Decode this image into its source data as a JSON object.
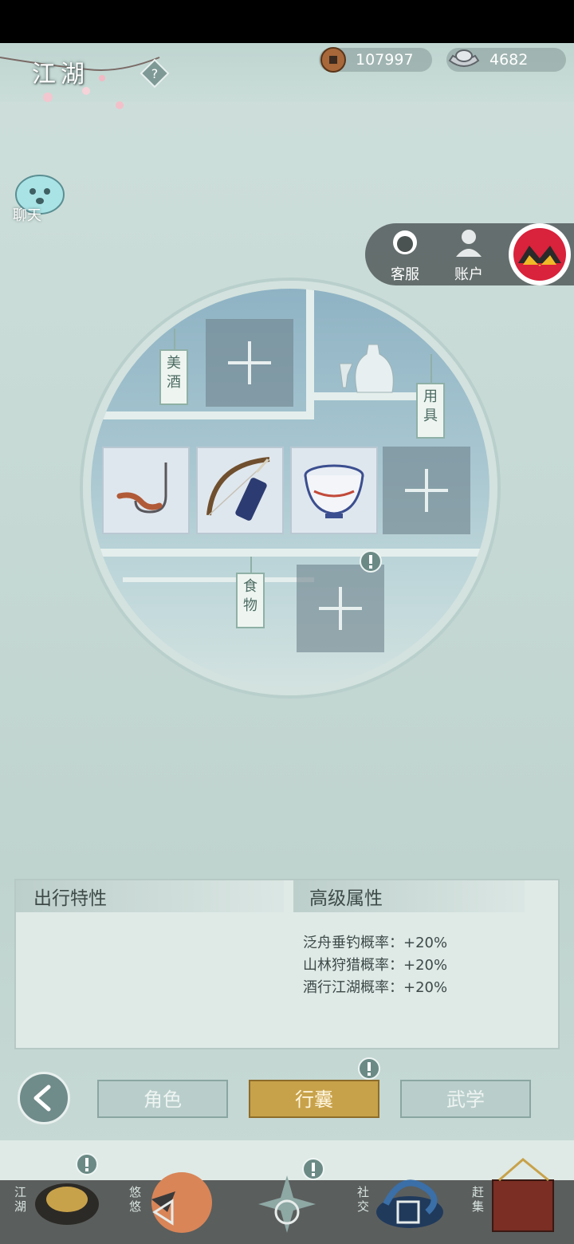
{
  "header": {
    "title": "江湖",
    "copper": "107997",
    "silver": "4682"
  },
  "chat": {
    "label": "聊天"
  },
  "service_panel": {
    "kefu": "客服",
    "account": "账户"
  },
  "shelf": {
    "tags": {
      "wine": "美酒",
      "tools": "用具",
      "food": "食物"
    },
    "items": [
      "fishing-hook",
      "bow-and-quiver",
      "porcelain-bowl"
    ]
  },
  "attributes": {
    "travel_header": "出行特性",
    "advanced_header": "高级属性",
    "lines": [
      "泛舟垂钓概率：+20%",
      "山林狩猎概率：+20%",
      "酒行江湖概率：+20%"
    ]
  },
  "tabs": {
    "role": "角色",
    "bag": "行囊",
    "martial": "武学",
    "active": "行囊"
  },
  "bottom_nav": {
    "jianghu": "江湖",
    "youyou": "悠悠",
    "shejiao": "社交",
    "ganji": "赶集"
  },
  "colors": {
    "accent_gold": "#c8a24a",
    "panel_bg": "#dfeae7",
    "nav_dark": "#464848"
  }
}
